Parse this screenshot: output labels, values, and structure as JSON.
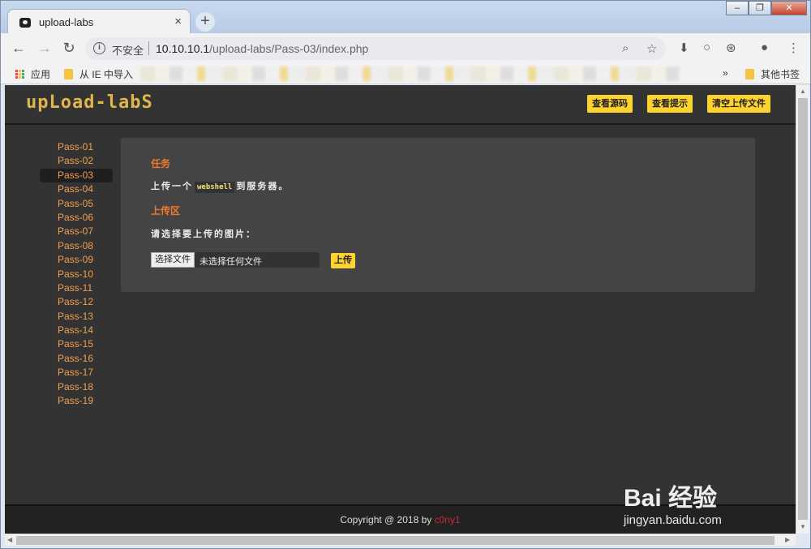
{
  "browser": {
    "tab_title": "upload-labs",
    "tab_close": "×",
    "new_tab": "+",
    "insecure_label": "不安全",
    "url_host": "10.10.10.1",
    "url_path": "/upload-labs/Pass-03/index.php",
    "bookmarks": {
      "apps": "应用",
      "ie_import": "从 IE 中导入",
      "more": "»",
      "other": "其他书签"
    },
    "window_buttons": [
      "–",
      "❐",
      "✕"
    ]
  },
  "site": {
    "logo": "upLoad-labS",
    "header_buttons": [
      "查看源码",
      "查看提示",
      "清空上传文件"
    ],
    "sidebar": [
      "Pass-01",
      "Pass-02",
      "Pass-03",
      "Pass-04",
      "Pass-05",
      "Pass-06",
      "Pass-07",
      "Pass-08",
      "Pass-09",
      "Pass-10",
      "Pass-11",
      "Pass-12",
      "Pass-13",
      "Pass-14",
      "Pass-15",
      "Pass-16",
      "Pass-17",
      "Pass-18",
      "Pass-19"
    ],
    "active_item": "Pass-03",
    "task": {
      "title": "任务",
      "text_before": "上传一个",
      "code": "webshell",
      "text_after": "到服务器。"
    },
    "upload": {
      "title": "上传区",
      "prompt": "请选择要上传的图片：",
      "choose_button": "选择文件",
      "no_file": "未选择任何文件",
      "submit": "上传"
    },
    "footer": {
      "text": "Copyright @ 2018 by",
      "author": "c0ny1"
    }
  },
  "watermark": {
    "brand": "Bai 经验",
    "url": "jingyan.baidu.com"
  }
}
